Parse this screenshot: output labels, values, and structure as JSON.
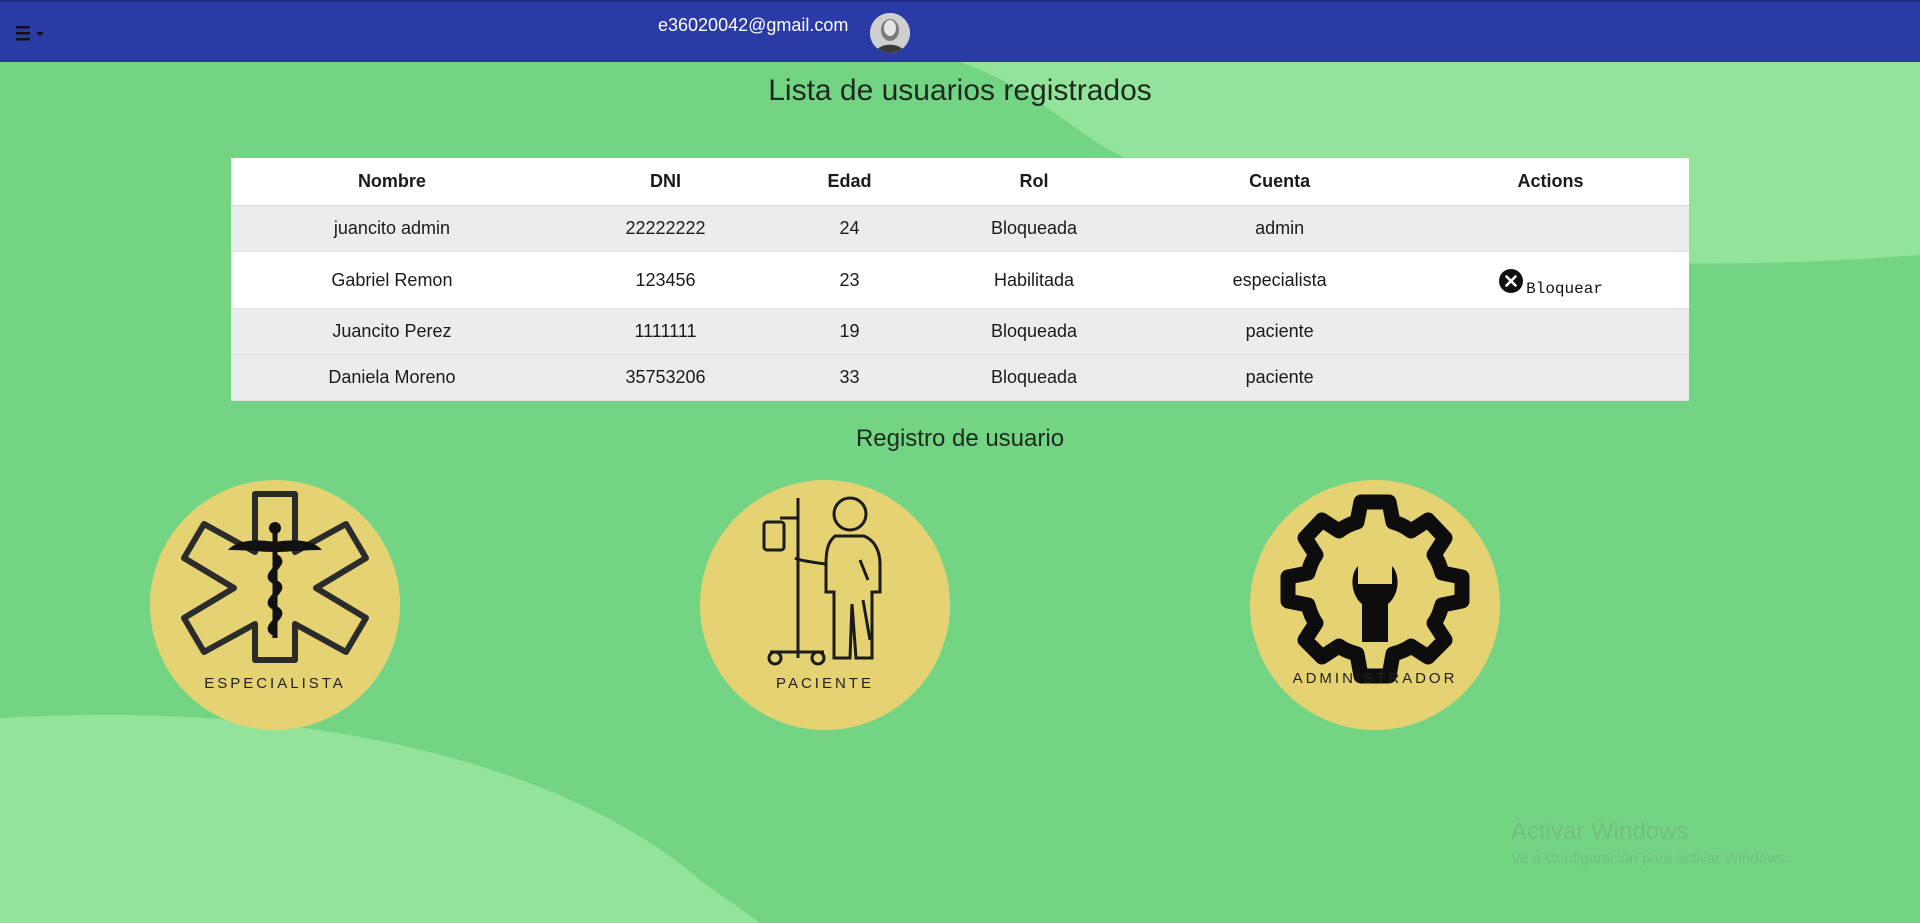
{
  "navbar": {
    "menu_icon": "hamburger-menu-icon",
    "user_email": "e36020042@gmail.com",
    "avatar_icon": "user-avatar"
  },
  "main": {
    "title": "Lista de usuarios registrados"
  },
  "users_table": {
    "headers": [
      "Nombre",
      "DNI",
      "Edad",
      "Rol",
      "Cuenta",
      "Actions"
    ],
    "rows": [
      {
        "nombre": "juancito admin",
        "dni": "22222222",
        "edad": "24",
        "rol": "Bloqueada",
        "cuenta": "admin",
        "action": ""
      },
      {
        "nombre": "Gabriel Remon",
        "dni": "123456",
        "edad": "23",
        "rol": "Habilitada",
        "cuenta": "especialista",
        "action": "Bloquear"
      },
      {
        "nombre": "Juancito Perez",
        "dni": "1111111",
        "edad": "19",
        "rol": "Bloqueada",
        "cuenta": "paciente",
        "action": ""
      },
      {
        "nombre": "Daniela Moreno",
        "dni": "35753206",
        "edad": "33",
        "rol": "Bloqueada",
        "cuenta": "paciente",
        "action": ""
      }
    ],
    "action_icon": "close-circle-icon"
  },
  "registration": {
    "title": "Registro de usuario",
    "options": [
      {
        "label": "ESPECIALISTA",
        "icon": "medical-star-icon"
      },
      {
        "label": "PACIENTE",
        "icon": "patient-iv-icon"
      },
      {
        "label": "ADMINISTRADOR",
        "icon": "gear-wrench-icon"
      }
    ]
  },
  "watermark": {
    "title": "Activar Windows",
    "subtitle": "Ve a Configuración para activar Windows."
  },
  "colors": {
    "navbar": "#2a3ba5",
    "background": "#73d584",
    "background_light": "#93e39b",
    "card": "#e5d273"
  }
}
